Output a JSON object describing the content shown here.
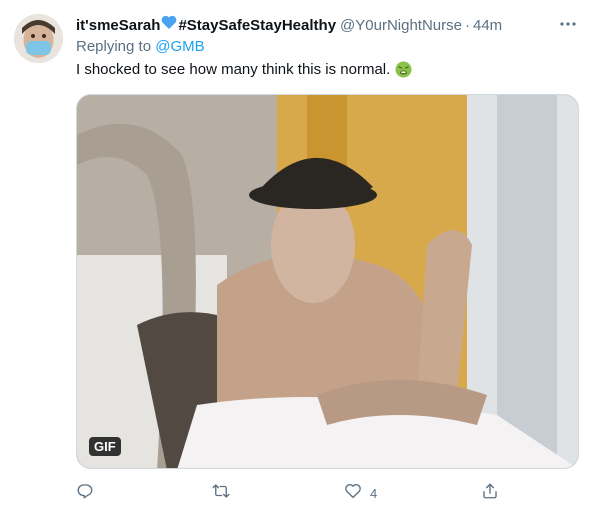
{
  "tweet": {
    "display_name": "it'smeSarah",
    "hashtag": "#StaySafeStayHealthy",
    "handle": "@Y0urNightNurse",
    "separator": "·",
    "time": "44m",
    "replying_prefix": "Replying to",
    "replying_to": "@GMB",
    "text": "I shocked to see how many think this is normal.",
    "media_badge": "GIF",
    "actions": {
      "reply_count": "",
      "retweet_count": "",
      "like_count": "4",
      "share_count": ""
    }
  },
  "icons": {
    "avatar": "avatar-masked-person",
    "heart": "blue-heart-icon",
    "emoji": "nauseated-face-icon",
    "more": "more-horizontal-icon",
    "reply": "reply-icon",
    "retweet": "retweet-icon",
    "like": "like-icon",
    "share": "share-icon"
  },
  "colors": {
    "link": "#1da1f2",
    "secondary_text": "#5b7083",
    "primary_text": "#0f1419",
    "heart": "#4aa3f0"
  }
}
